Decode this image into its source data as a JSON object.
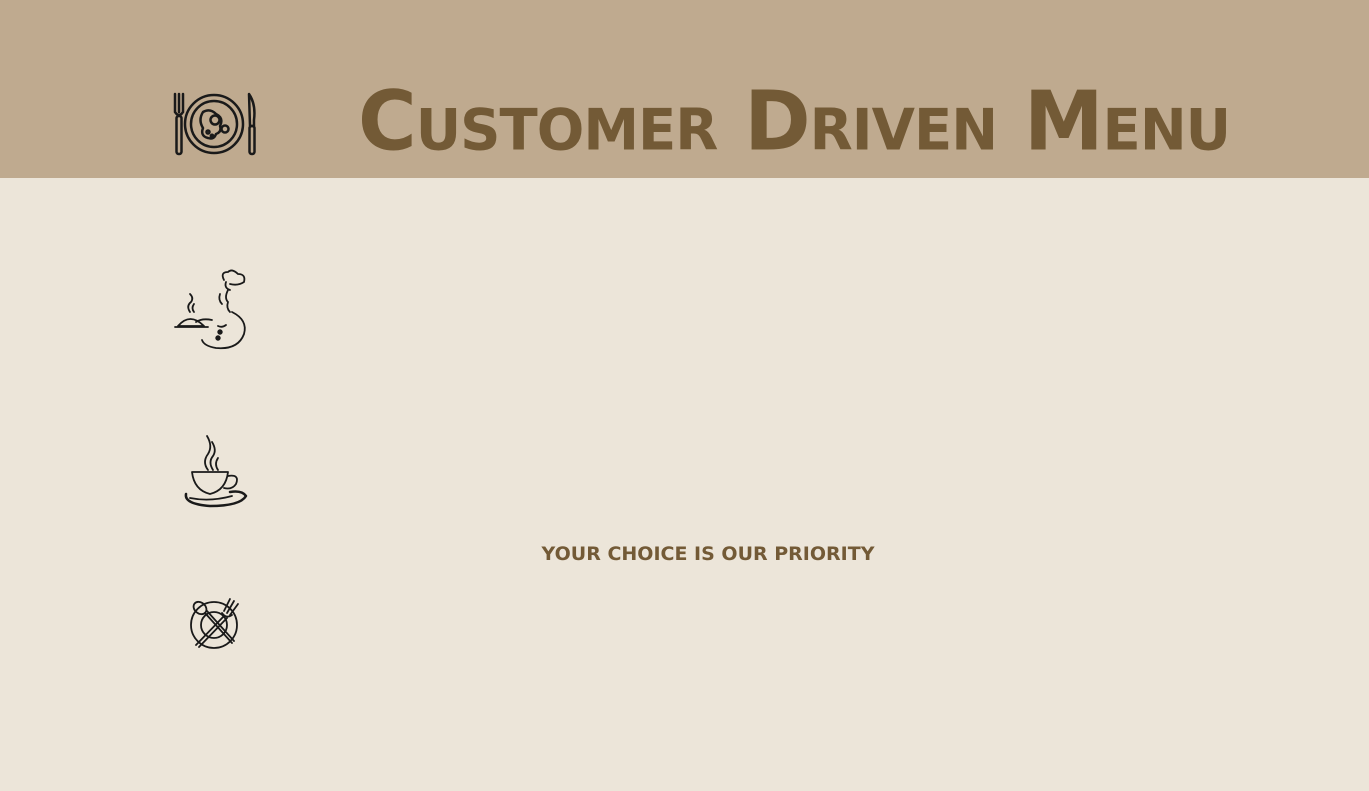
{
  "header": {
    "title": "Customer Driven Menu"
  },
  "tagline": "YOUR CHOICE IS OUR PRIORITY",
  "icons": [
    "plate-cutlery-icon",
    "chef-serving-icon",
    "coffee-cup-icon",
    "crossed-spoon-fork-icon"
  ],
  "colors": {
    "header_background": "#BFAA8F",
    "page_background": "#ECE5D9",
    "title_text": "#735A36",
    "icon_stroke": "#1A1A1A"
  }
}
